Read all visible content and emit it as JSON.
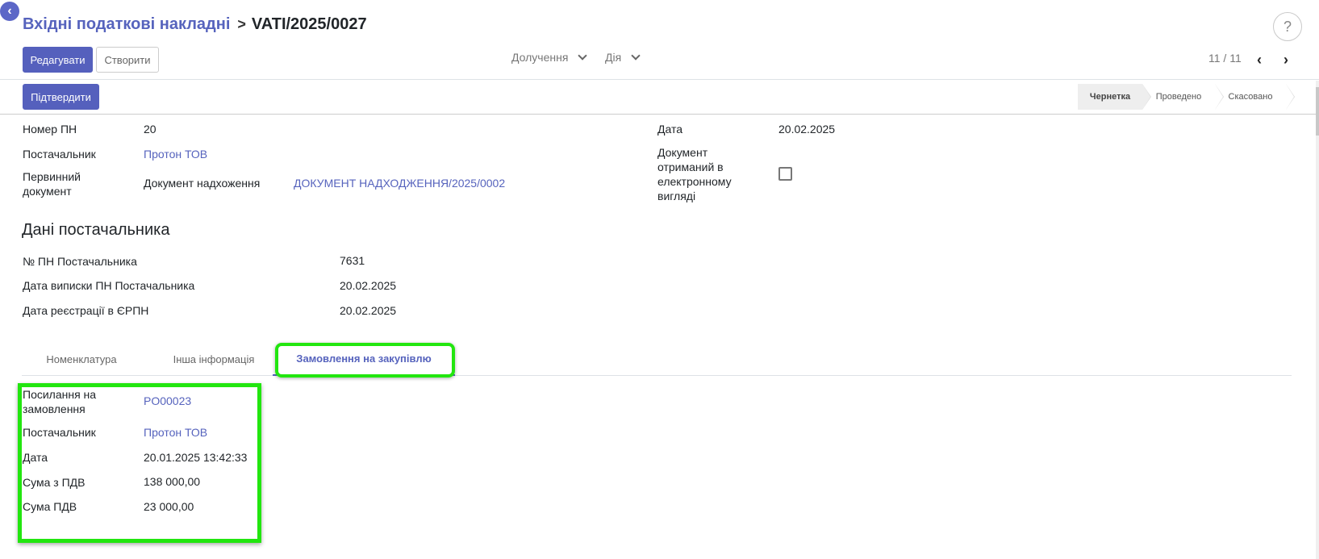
{
  "header": {
    "breadcrumb_parent": "Вхідні податкові накладні",
    "breadcrumb_sep": ">",
    "breadcrumb_current": "VATI/2025/0027",
    "help": "?"
  },
  "toolbar": {
    "edit_label": "Редагувати",
    "create_label": "Створити",
    "attachments_label": "Долучення",
    "action_label": "Дія",
    "pager": "11 / 11"
  },
  "statusbar": {
    "confirm_label": "Підтвердити",
    "steps": [
      "Чернетка",
      "Проведено",
      "Скасовано"
    ],
    "active_step": "Чернетка"
  },
  "form": {
    "number_label": "Номер ПН",
    "number_value": "20",
    "supplier_label": "Постачальник",
    "supplier_value": "Протон ТОВ",
    "primary_doc_label": "Первинний документ",
    "primary_doc_type": "Документ надхоження",
    "primary_doc_value": "ДОКУМЕНТ НАДХОДЖЕННЯ/2025/0002",
    "date_label": "Дата",
    "date_value": "20.02.2025",
    "electronic_label": "Документ отриманий в електронному вигляді",
    "electronic_checked": false
  },
  "supplier_data": {
    "title": "Дані постачальника",
    "inv_no_label": "№ ПН Постачальника",
    "inv_no_value": "7631",
    "issue_date_label": "Дата виписки ПН Постачальника",
    "issue_date_value": "20.02.2025",
    "reg_date_label": "Дата реєстрації в ЄРПН",
    "reg_date_value": "20.02.2025"
  },
  "tabs": [
    {
      "label": "Номенклатура"
    },
    {
      "label": "Інша інформація"
    },
    {
      "label": "Замовлення на закупівлю"
    }
  ],
  "purchase_order": {
    "ref_label": "Посилання на замовлення",
    "ref_value": "PO00023",
    "supplier_label": "Постачальник",
    "supplier_value": "Протон ТОВ",
    "date_label": "Дата",
    "date_value": "20.01.2025 13:42:33",
    "total_label": "Сума з ПДВ",
    "total_value": "138 000,00",
    "vat_label": "Сума ПДВ",
    "vat_value": "23 000,00"
  },
  "colors": {
    "primary": "#5560bd",
    "link": "#5663bd",
    "highlight": "#22e60f"
  }
}
